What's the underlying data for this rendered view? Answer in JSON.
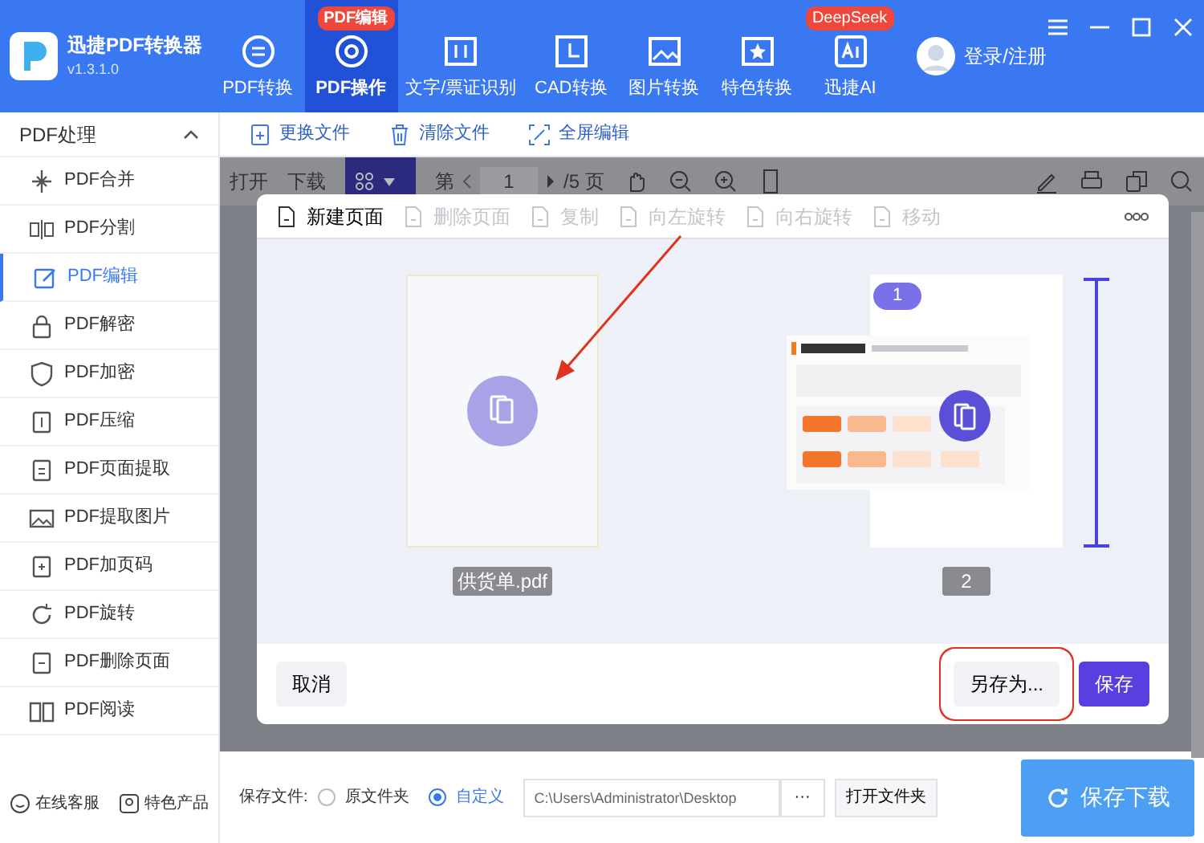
{
  "app": {
    "title": "迅捷PDF转换器",
    "version": "v1.3.1.0"
  },
  "nav_tabs": [
    {
      "label": "PDF转换",
      "selected": false
    },
    {
      "label": "PDF操作",
      "selected": true,
      "badge": "PDF编辑"
    },
    {
      "label": "文字/票证识别",
      "selected": false
    },
    {
      "label": "CAD转换",
      "selected": false
    },
    {
      "label": "图片转换",
      "selected": false
    },
    {
      "label": "特色转换",
      "selected": false
    },
    {
      "label": "迅捷AI",
      "selected": false,
      "badge": "DeepSeek"
    }
  ],
  "account": {
    "label": "登录/注册"
  },
  "sidebar": {
    "title": "PDF处理",
    "expanded": true,
    "items": [
      {
        "label": "PDF合并",
        "selected": false
      },
      {
        "label": "PDF分割",
        "selected": false
      },
      {
        "label": "PDF编辑",
        "selected": true
      },
      {
        "label": "PDF解密",
        "selected": false
      },
      {
        "label": "PDF加密",
        "selected": false
      },
      {
        "label": "PDF压缩",
        "selected": false
      },
      {
        "label": "PDF页面提取",
        "selected": false
      },
      {
        "label": "PDF提取图片",
        "selected": false
      },
      {
        "label": "PDF加页码",
        "selected": false
      },
      {
        "label": "PDF旋转",
        "selected": false
      },
      {
        "label": "PDF删除页面",
        "selected": false
      },
      {
        "label": "PDF阅读",
        "selected": false
      }
    ]
  },
  "sidebar_footer": [
    "在线客服",
    "特色产品"
  ],
  "file_toolbar": [
    "更换文件",
    "清除文件",
    "全屏编辑"
  ],
  "viewer_toolbar": {
    "open": "打开",
    "download": "下载",
    "page_prefix": "第",
    "page": "1",
    "page_total": "/5 页"
  },
  "dialog": {
    "tools": [
      {
        "label": "新建页面",
        "disabled": false
      },
      {
        "label": "删除页面",
        "disabled": true
      },
      {
        "label": "复制",
        "disabled": true
      },
      {
        "label": "向左旋转",
        "disabled": true
      },
      {
        "label": "向右旋转",
        "disabled": true
      },
      {
        "label": "移动",
        "disabled": true
      }
    ],
    "pages": [
      {
        "kind": "blank",
        "label": "供货单.pdf"
      },
      {
        "kind": "document",
        "label": "2",
        "badge": "1"
      }
    ],
    "cancel": "取消",
    "save_as": "另存为...",
    "save": "保存"
  },
  "save_options": {
    "label": "保存文件:",
    "options": [
      {
        "label": "原文件夹",
        "selected": false
      },
      {
        "label": "自定义",
        "selected": true
      }
    ],
    "path": "C:\\Users\\Administrator\\Desktop",
    "browse": "···",
    "open_folder": "打开文件夹"
  },
  "save_button": "保存下载"
}
